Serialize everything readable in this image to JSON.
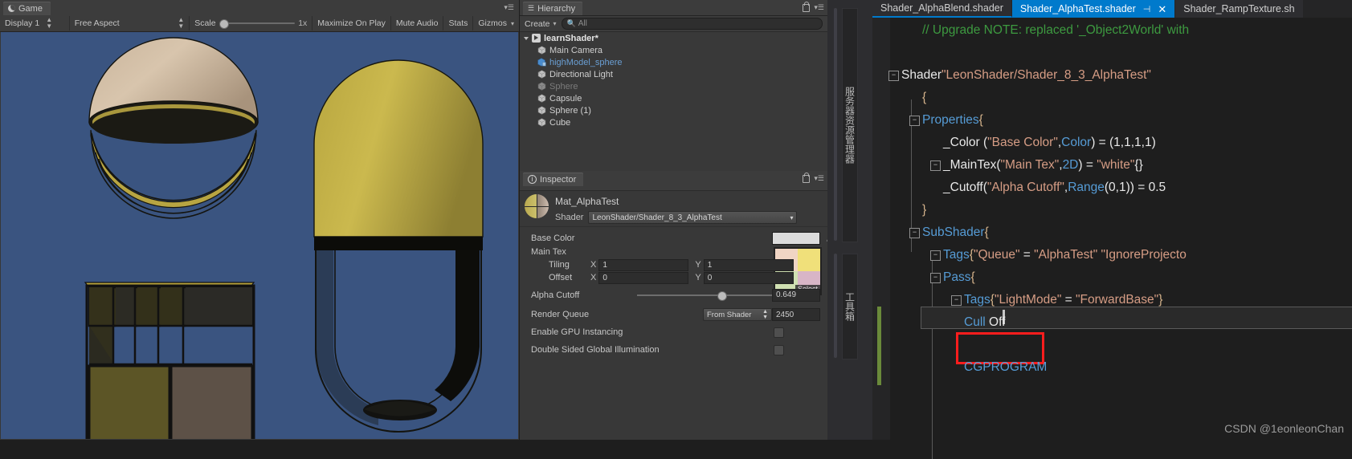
{
  "game_view": {
    "tab_label": "Game",
    "tab_icon": "moon-icon",
    "toolbar": {
      "display": "Display 1",
      "aspect": "Free Aspect",
      "scale_label": "Scale",
      "scale_value": "1x",
      "maximize_on_play": "Maximize On Play",
      "mute_audio": "Mute Audio",
      "stats": "Stats",
      "gizmos": "Gizmos"
    },
    "viewport_bg": "#3a5480"
  },
  "hierarchy": {
    "tab_label": "Hierarchy",
    "create_label": "Create",
    "search_placeholder": "All",
    "items": [
      {
        "label": "learnShader*",
        "depth": 0,
        "state": "root",
        "icon": "unity-scene-icon"
      },
      {
        "label": "Main Camera",
        "depth": 1,
        "state": "normal",
        "icon": "gameobject-icon"
      },
      {
        "label": "highModel_sphere",
        "depth": 1,
        "state": "selected",
        "icon": "prefab-icon"
      },
      {
        "label": "Directional Light",
        "depth": 1,
        "state": "normal",
        "icon": "gameobject-icon"
      },
      {
        "label": "Sphere",
        "depth": 1,
        "state": "disabled",
        "icon": "gameobject-icon"
      },
      {
        "label": "Capsule",
        "depth": 1,
        "state": "normal",
        "icon": "gameobject-icon"
      },
      {
        "label": "Sphere (1)",
        "depth": 1,
        "state": "normal",
        "icon": "gameobject-icon"
      },
      {
        "label": "Cube",
        "depth": 1,
        "state": "normal",
        "icon": "gameobject-icon"
      }
    ]
  },
  "inspector": {
    "tab_label": "Inspector",
    "material_name": "Mat_AlphaTest",
    "shader_label": "Shader",
    "shader_value": "LeonShader/Shader_8_3_AlphaTest",
    "base_color_label": "Base Color",
    "base_color_value": "#DCDCDC",
    "main_tex_label": "Main Tex",
    "texture_select_label": "Select",
    "texture_quadrants": [
      "#f0d5c4",
      "#f0e07a",
      "#d0e0b2",
      "#d8b5c6"
    ],
    "tiling_label": "Tiling",
    "tiling_x": "1",
    "tiling_y": "1",
    "offset_label": "Offset",
    "offset_x": "0",
    "offset_y": "0",
    "axis_x": "X",
    "axis_y": "Y",
    "alpha_cutoff_label": "Alpha Cutoff",
    "alpha_cutoff_value": "0.649",
    "render_queue_label": "Render Queue",
    "render_queue_mode": "From Shader",
    "render_queue_value": "2450",
    "gpu_instancing_label": "Enable GPU Instancing",
    "gpu_instancing_checked": false,
    "double_sided_label": "Double Sided Global Illumination",
    "double_sided_checked": false
  },
  "vs_side_tabs": [
    {
      "label": "服务器资源管理器"
    },
    {
      "label": "工具箱"
    }
  ],
  "editor": {
    "tabs": [
      {
        "label": "Shader_AlphaBlend.shader",
        "active": false,
        "modified_underline": true
      },
      {
        "label": "Shader_AlphaTest.shader",
        "active": true,
        "pin_icon": "pin-icon",
        "close_icon": "close-icon"
      },
      {
        "label": "Shader_RampTexture.sh",
        "active": false
      }
    ],
    "watermark": "CSDN @1eonleonChan",
    "annotation": {
      "target": "Cull Off",
      "color": "#FC1D1D"
    },
    "lines": [
      {
        "indent": 1,
        "fold": false,
        "tokens": [
          {
            "t": "// Upgrade NOTE: replaced '_Object2World' with",
            "c": "cmt"
          }
        ]
      },
      {
        "indent": 0,
        "fold": false,
        "tokens": []
      },
      {
        "indent": 0,
        "fold": true,
        "tokens": [
          {
            "t": "Shader",
            "c": "plain"
          },
          {
            "t": "\"LeonShader/Shader_8_3_AlphaTest\"",
            "c": "str"
          }
        ]
      },
      {
        "indent": 1,
        "fold": false,
        "tokens": [
          {
            "t": "{",
            "c": "brace"
          }
        ]
      },
      {
        "indent": 1,
        "fold": true,
        "tokens": [
          {
            "t": "Properties",
            "c": "kw"
          },
          {
            "t": "{",
            "c": "brace"
          }
        ]
      },
      {
        "indent": 2,
        "fold": false,
        "tokens": [
          {
            "t": "_Color (",
            "c": "plain"
          },
          {
            "t": "\"Base Color\"",
            "c": "str"
          },
          {
            "t": ",",
            "c": "plain"
          },
          {
            "t": "Color",
            "c": "kw"
          },
          {
            "t": ") = (1,1,1,1)",
            "c": "plain"
          }
        ]
      },
      {
        "indent": 2,
        "fold": true,
        "tokens": [
          {
            "t": "_MainTex(",
            "c": "plain"
          },
          {
            "t": "\"Main Tex\"",
            "c": "str"
          },
          {
            "t": ",",
            "c": "plain"
          },
          {
            "t": "2D",
            "c": "kw"
          },
          {
            "t": ") = ",
            "c": "plain"
          },
          {
            "t": "\"white\"",
            "c": "str"
          },
          {
            "t": "{}",
            "c": "plain"
          }
        ]
      },
      {
        "indent": 2,
        "fold": false,
        "tokens": [
          {
            "t": "_Cutoff(",
            "c": "plain"
          },
          {
            "t": "\"Alpha Cutoff\"",
            "c": "str"
          },
          {
            "t": ",",
            "c": "plain"
          },
          {
            "t": "Range",
            "c": "kw"
          },
          {
            "t": "(0,1)) = 0.5",
            "c": "plain"
          }
        ]
      },
      {
        "indent": 1,
        "fold": false,
        "tokens": [
          {
            "t": "}",
            "c": "brace"
          }
        ]
      },
      {
        "indent": 1,
        "fold": true,
        "tokens": [
          {
            "t": "SubShader",
            "c": "kw"
          },
          {
            "t": "{",
            "c": "brace"
          }
        ]
      },
      {
        "indent": 2,
        "fold": true,
        "tokens": [
          {
            "t": "Tags",
            "c": "kw"
          },
          {
            "t": "{",
            "c": "brace"
          },
          {
            "t": "\"Queue\"",
            "c": "str"
          },
          {
            "t": " = ",
            "c": "plain"
          },
          {
            "t": "\"AlphaTest\" \"IgnoreProjecto",
            "c": "str"
          }
        ]
      },
      {
        "indent": 2,
        "fold": true,
        "tokens": [
          {
            "t": "Pass",
            "c": "kw"
          },
          {
            "t": "{",
            "c": "brace"
          }
        ]
      },
      {
        "indent": 3,
        "fold": true,
        "current": true,
        "tokens": [
          {
            "t": "Tags",
            "c": "kw"
          },
          {
            "t": "{",
            "c": "brace"
          },
          {
            "t": "\"LightMode\"",
            "c": "str"
          },
          {
            "t": " = ",
            "c": "plain"
          },
          {
            "t": "\"ForwardBase\"",
            "c": "str"
          },
          {
            "t": "}",
            "c": "brace"
          }
        ]
      },
      {
        "indent": 3,
        "fold": false,
        "boxed": true,
        "tokens": [
          {
            "t": "Cull",
            "c": "kw"
          },
          {
            "t": " Off",
            "c": "plain"
          }
        ]
      },
      {
        "indent": 3,
        "fold": false,
        "tokens": []
      },
      {
        "indent": 3,
        "fold": false,
        "tokens": [
          {
            "t": "CGPROGRAM",
            "c": "kw"
          }
        ]
      }
    ]
  }
}
